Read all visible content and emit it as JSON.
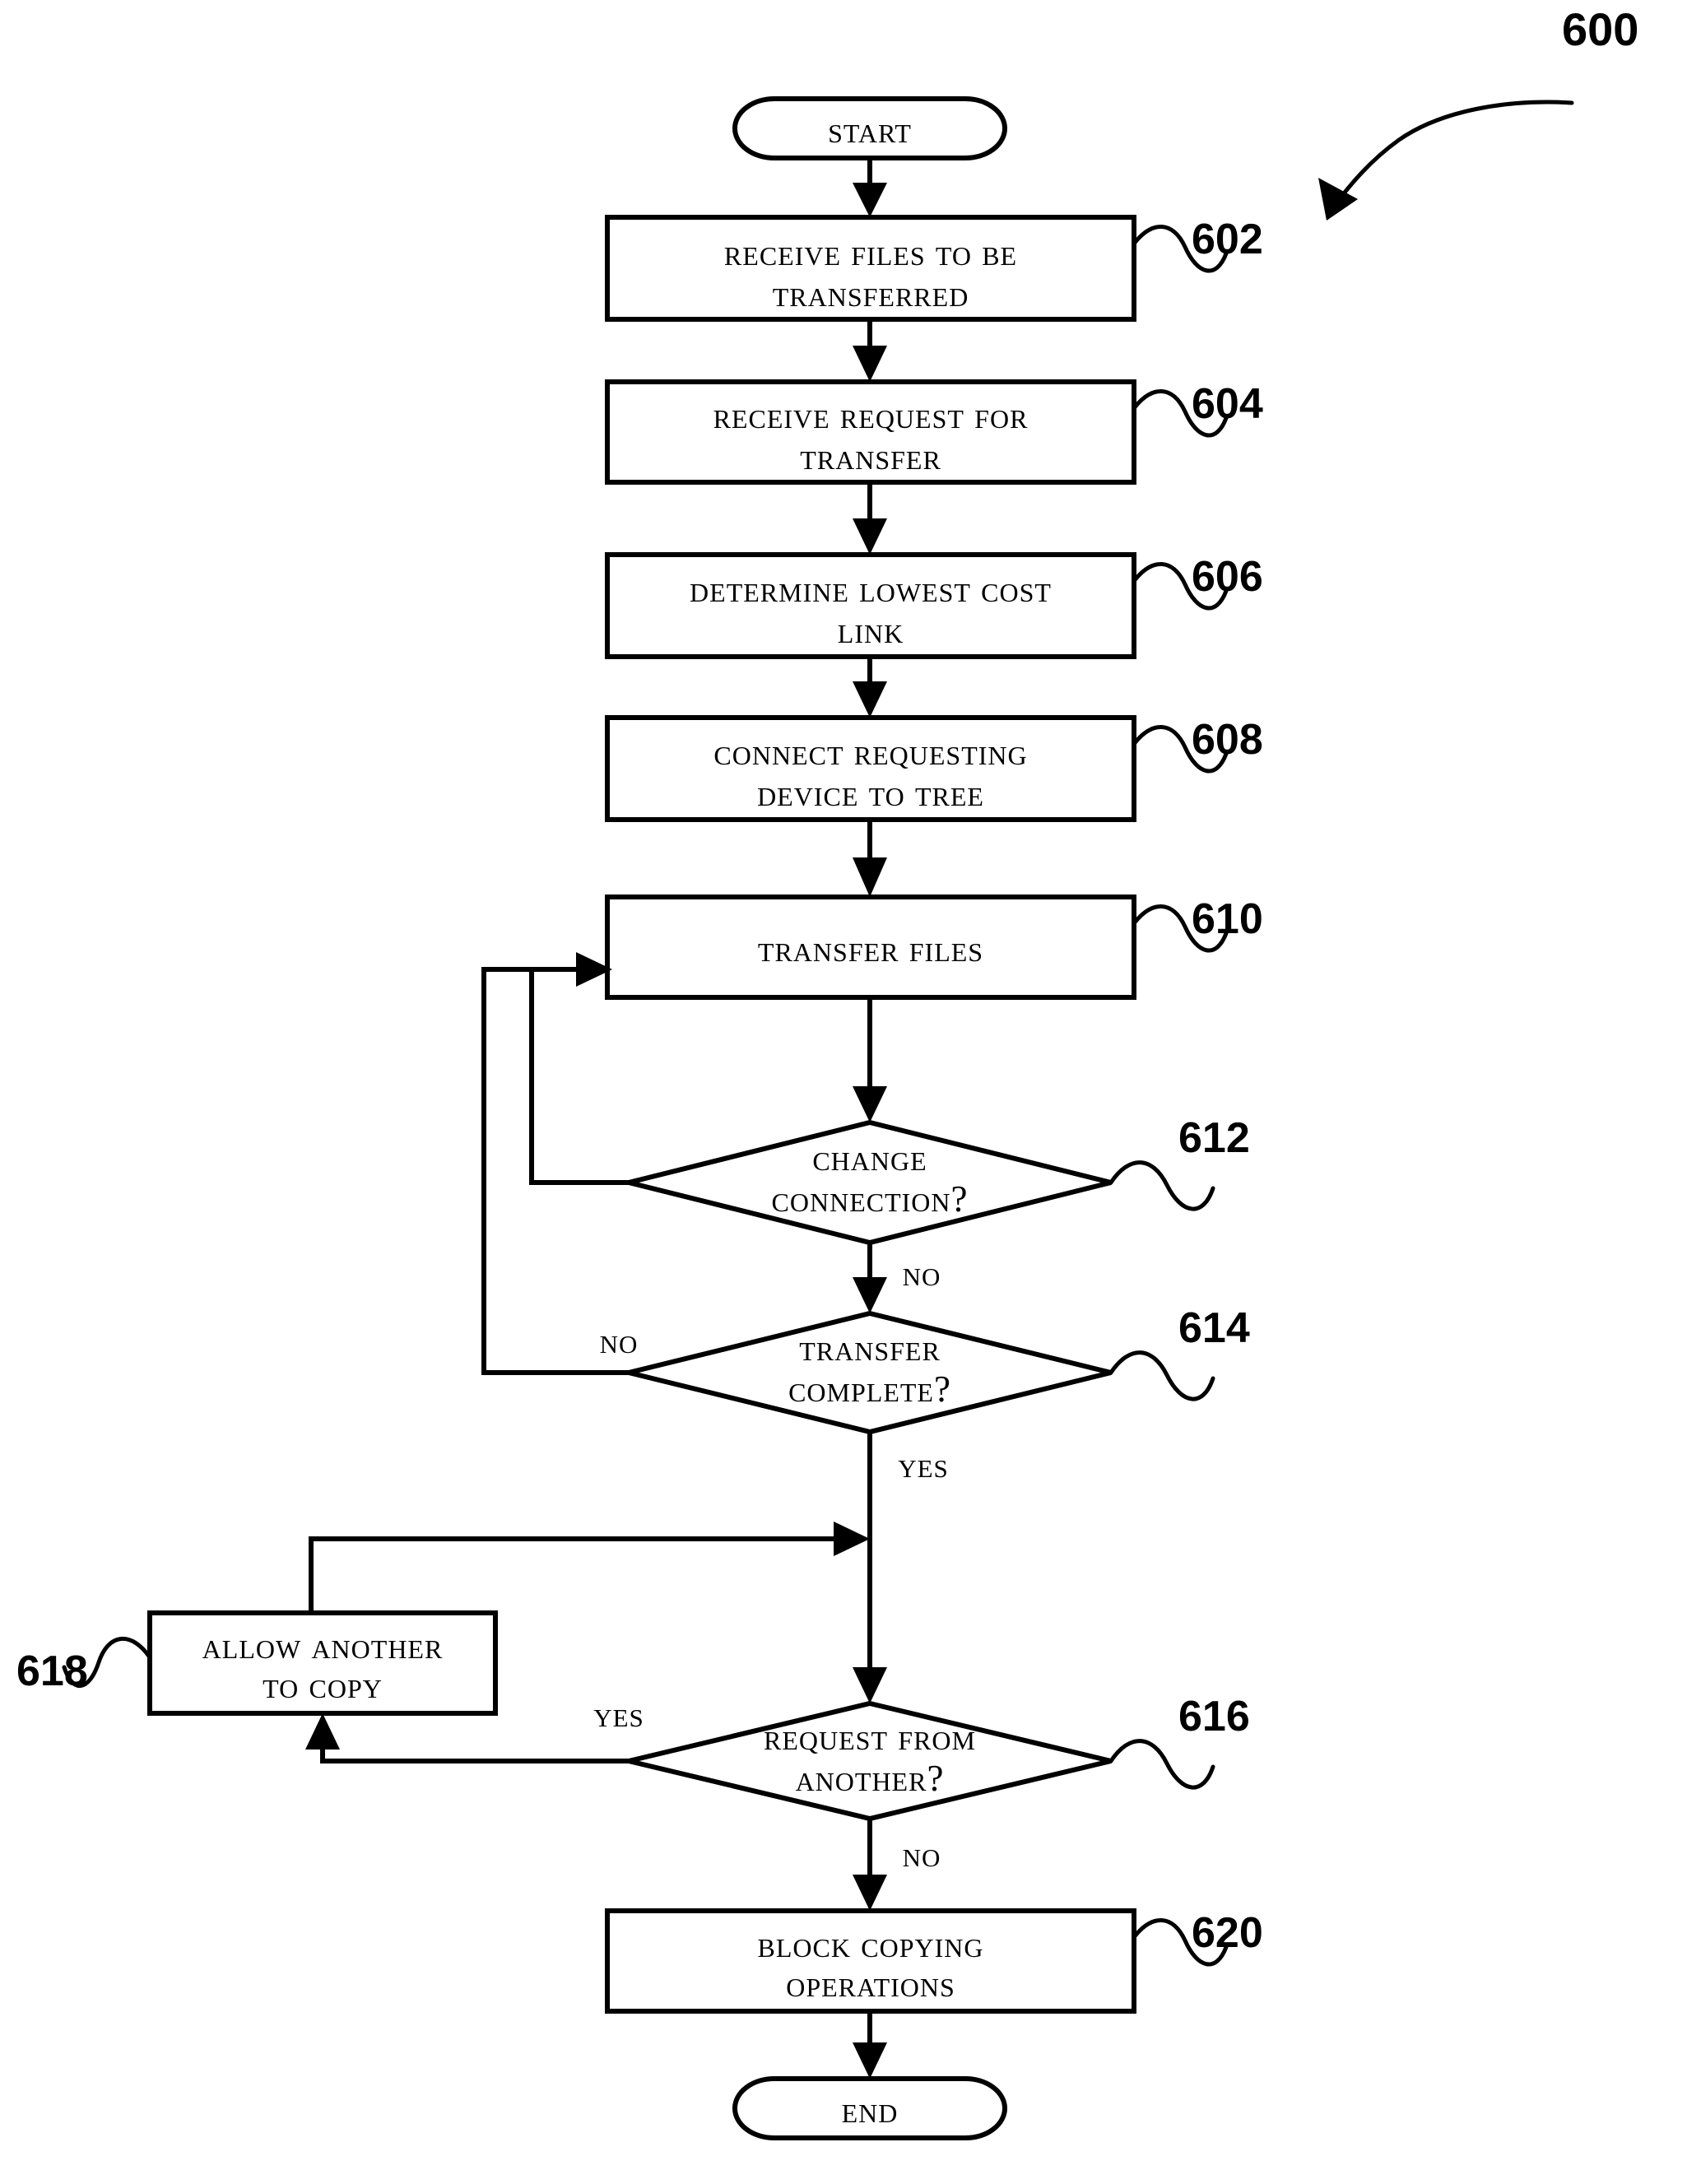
{
  "figure": {
    "label": "600",
    "type": "patent-flowchart",
    "title_visible": false
  },
  "terminators": {
    "start": "Start",
    "end": "End"
  },
  "nodes": [
    {
      "id": "start",
      "kind": "terminator",
      "lines": [
        "Start"
      ],
      "ref": null
    },
    {
      "id": "n602",
      "kind": "process",
      "lines": [
        "Receive Files To Be",
        "Transferred"
      ],
      "ref": "602"
    },
    {
      "id": "n604",
      "kind": "process",
      "lines": [
        "Receive Request For",
        "Transfer"
      ],
      "ref": "604"
    },
    {
      "id": "n606",
      "kind": "process",
      "lines": [
        "Determine Lowest Cost",
        "Link"
      ],
      "ref": "606"
    },
    {
      "id": "n608",
      "kind": "process",
      "lines": [
        "Connect Requesting",
        "Device to Tree"
      ],
      "ref": "608"
    },
    {
      "id": "n610",
      "kind": "process",
      "lines": [
        "Transfer Files"
      ],
      "ref": "610"
    },
    {
      "id": "n612",
      "kind": "decision",
      "lines": [
        "Change",
        "Connection?"
      ],
      "ref": "612"
    },
    {
      "id": "n614",
      "kind": "decision",
      "lines": [
        "Transfer",
        "Complete?"
      ],
      "ref": "614"
    },
    {
      "id": "n616",
      "kind": "decision",
      "lines": [
        "Request From",
        "Another?"
      ],
      "ref": "616"
    },
    {
      "id": "n618",
      "kind": "process",
      "lines": [
        "Allow Another",
        "to Copy"
      ],
      "ref": "618"
    },
    {
      "id": "n620",
      "kind": "process",
      "lines": [
        "Block Copying",
        "Operations"
      ],
      "ref": "620"
    },
    {
      "id": "end",
      "kind": "terminator",
      "lines": [
        "End"
      ],
      "ref": null
    }
  ],
  "branch_labels": {
    "b612_no": "No",
    "b614_no": "No",
    "b614_yes": "Yes",
    "b616_yes": "Yes",
    "b616_no": "No"
  },
  "edges": [
    {
      "from": "start",
      "to": "n602",
      "label": ""
    },
    {
      "from": "n602",
      "to": "n604",
      "label": ""
    },
    {
      "from": "n604",
      "to": "n606",
      "label": ""
    },
    {
      "from": "n606",
      "to": "n608",
      "label": ""
    },
    {
      "from": "n608",
      "to": "n610",
      "label": ""
    },
    {
      "from": "n610",
      "to": "n612",
      "label": ""
    },
    {
      "from": "n612",
      "to": "n610",
      "label": "Yes-implied-left-loop"
    },
    {
      "from": "n612",
      "to": "n614",
      "label": "No"
    },
    {
      "from": "n614",
      "to": "n610",
      "label": "No"
    },
    {
      "from": "n614",
      "to": "n616",
      "label": "Yes"
    },
    {
      "from": "n616",
      "to": "n618",
      "label": "Yes"
    },
    {
      "from": "n618",
      "to": "n616",
      "label": "loop-to-spine"
    },
    {
      "from": "n616",
      "to": "n620",
      "label": "No"
    },
    {
      "from": "n620",
      "to": "end",
      "label": ""
    }
  ],
  "refs": {
    "r602": "602",
    "r604": "604",
    "r606": "606",
    "r608": "608",
    "r610": "610",
    "r612": "612",
    "r614": "614",
    "r616": "616",
    "r618": "618",
    "r620": "620"
  },
  "colors": {
    "ink": "#000000",
    "paper": "#ffffff"
  },
  "text": {
    "start": "Start",
    "n602_l1": "Receive Files To Be",
    "n602_l2": "Transferred",
    "n604_l1": "Receive Request For",
    "n604_l2": "Transfer",
    "n606_l1": "Determine Lowest Cost",
    "n606_l2": "Link",
    "n608_l1": "Connect Requesting",
    "n608_l2": "Device to Tree",
    "n610_l1": "Transfer Files",
    "n612_l1": "Change",
    "n612_l2": "Connection?",
    "n614_l1": "Transfer",
    "n614_l2": "Complete?",
    "n616_l1": "Request From",
    "n616_l2": "Another?",
    "n618_l1": "Allow Another",
    "n618_l2": "to Copy",
    "n620_l1": "Block Copying",
    "n620_l2": "Operations",
    "end": "End"
  }
}
